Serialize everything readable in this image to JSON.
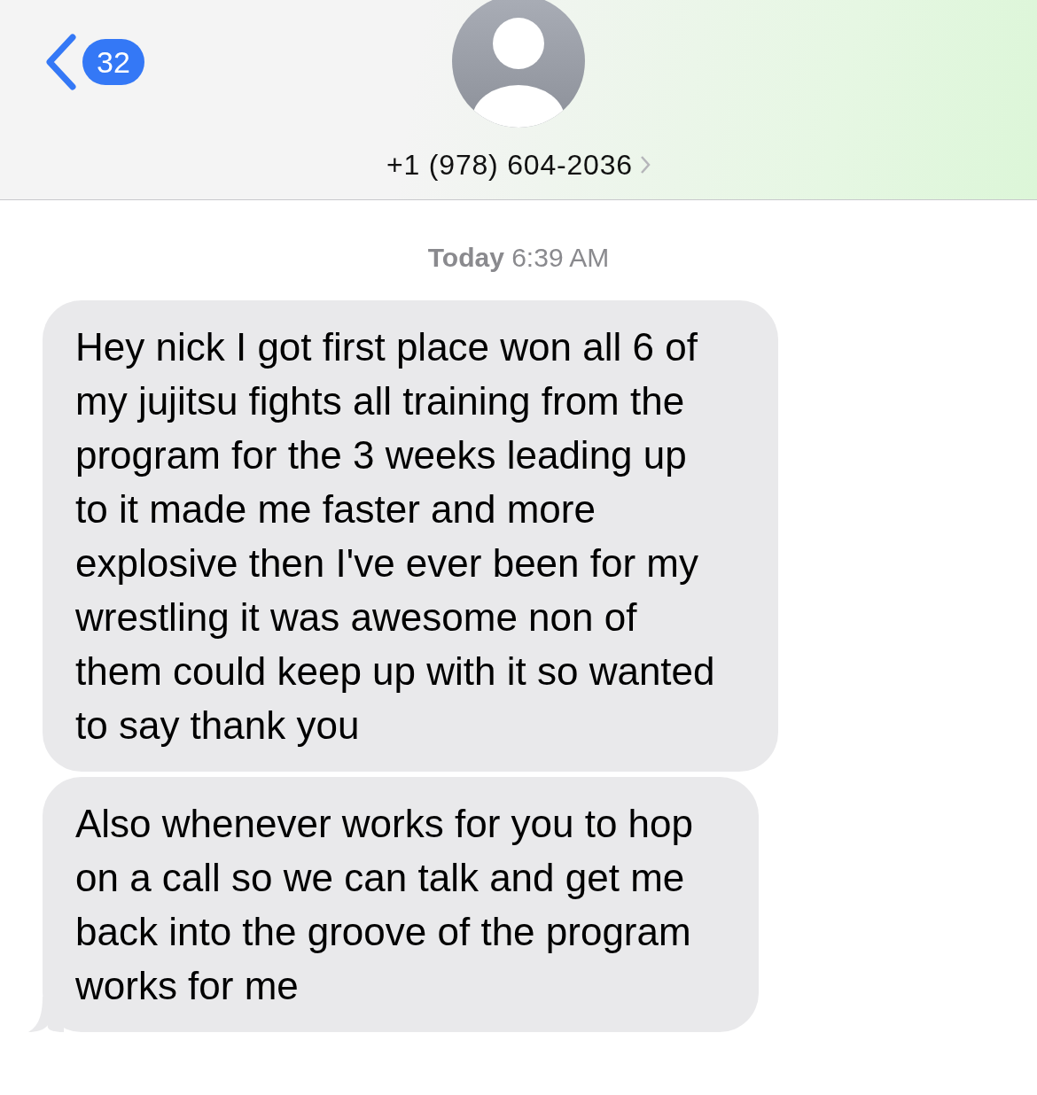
{
  "header": {
    "unread_count": "32",
    "contact": "+1 (978) 604-2036"
  },
  "timestamp": {
    "day": "Today",
    "time": "6:39 AM"
  },
  "messages": [
    {
      "text": "Hey nick I got first place won all 6 of my jujitsu fights all training from the program for the 3 weeks leading up to it made me faster and more explosive then I've ever been for my wrestling it was awesome non of them could keep up with it so wanted to say thank you",
      "tail": false
    },
    {
      "text": "Also whenever works for you to hop on a call so we can talk and get me back into the groove of the program works for me",
      "tail": true
    }
  ]
}
